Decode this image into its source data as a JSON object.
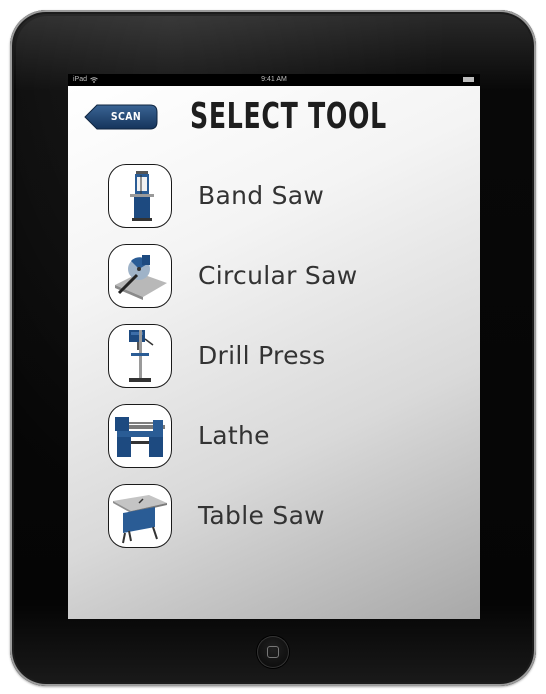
{
  "status_bar": {
    "carrier": "iPad",
    "time": "9:41 AM",
    "icons": [
      "wifi-icon",
      "battery-icon"
    ]
  },
  "header": {
    "back_button_label": "SCAN",
    "title": "SELECT TOOL"
  },
  "tools": [
    {
      "label": "Band Saw",
      "icon": "band-saw-icon"
    },
    {
      "label": "Circular Saw",
      "icon": "circular-saw-icon"
    },
    {
      "label": "Drill Press",
      "icon": "drill-press-icon"
    },
    {
      "label": "Lathe",
      "icon": "lathe-icon"
    },
    {
      "label": "Table Saw",
      "icon": "table-saw-icon"
    }
  ],
  "colors": {
    "accent_blue": "#1d3f6b",
    "title_text": "#1e1e1e",
    "label_text": "#333333",
    "device_frame": "#0a0a0a"
  }
}
